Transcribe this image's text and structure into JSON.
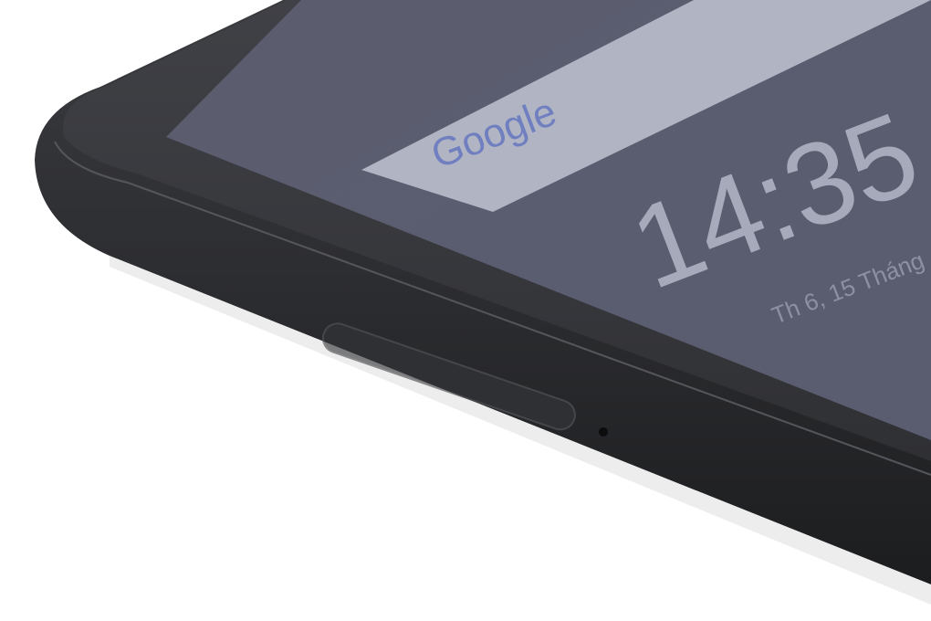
{
  "scene": {
    "description_visible_object": "phone-edge-closeup",
    "background_color": "#ffffff",
    "body_color": "#2b2c2f",
    "screen_color": "#5d5f72"
  },
  "lockscreen": {
    "search_brand": "Google",
    "time": "14:35",
    "date": "Th 6, 15 Tháng"
  }
}
